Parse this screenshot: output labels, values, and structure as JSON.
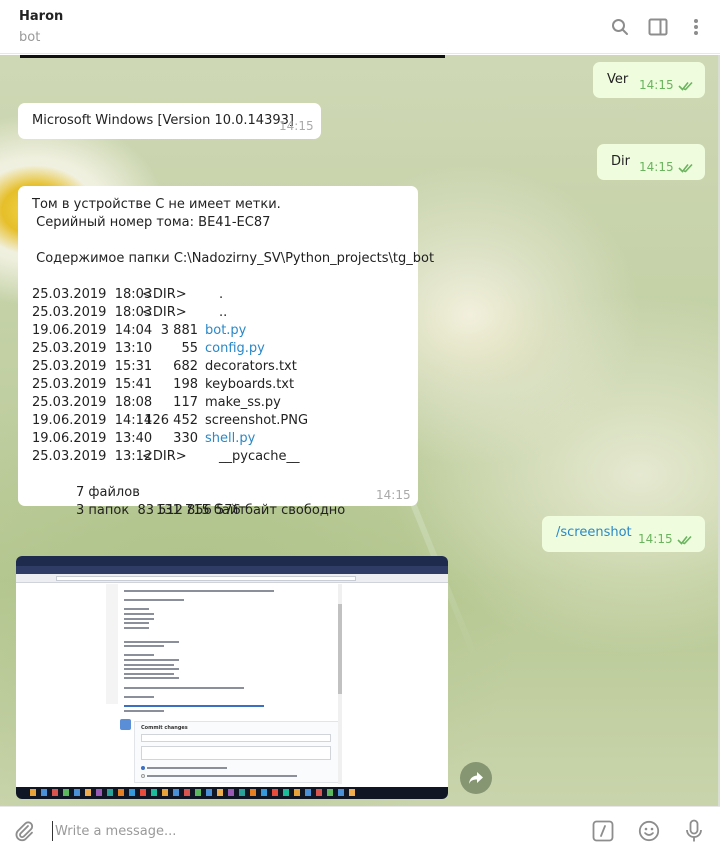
{
  "header": {
    "name": "Haron",
    "status": "bot"
  },
  "messages": {
    "ver": {
      "text": "Ver",
      "time": "14:15"
    },
    "ver_reply": {
      "text": "Microsoft Windows [Version 10.0.14393]",
      "time": "14:15"
    },
    "dir": {
      "text": "Dir",
      "time": "14:15"
    },
    "dir_reply": {
      "line1": "Том в устройстве C не имеет метки.",
      "line2": " Серийный номер тома: BE41-EC87",
      "line3": " Содержимое папки C:\\Nadozirny_SV\\Python_projects\\tg_bot",
      "entries": [
        {
          "date": "25.03.2019  18:03",
          "dir": "<DIR>",
          "size": "",
          "name": "."
        },
        {
          "date": "25.03.2019  18:03",
          "dir": "<DIR>",
          "size": "",
          "name": ".."
        },
        {
          "date": "19.06.2019  14:04",
          "dir": "",
          "size": "3 881",
          "name": "bot.py"
        },
        {
          "date": "25.03.2019  13:10",
          "dir": "",
          "size": "55",
          "name": "config.py"
        },
        {
          "date": "25.03.2019  15:31",
          "dir": "",
          "size": "682",
          "name": "decorators.txt"
        },
        {
          "date": "25.03.2019  15:41",
          "dir": "",
          "size": "198",
          "name": "keyboards.txt"
        },
        {
          "date": "25.03.2019  18:08",
          "dir": "",
          "size": "117",
          "name": "make_ss.py"
        },
        {
          "date": "19.06.2019  14:14",
          "dir": "",
          "size": "126 452",
          "name": "screenshot.PNG"
        },
        {
          "date": "19.06.2019  13:40",
          "dir": "",
          "size": "330",
          "name": "shell.py"
        },
        {
          "date": "25.03.2019  13:12",
          "dir": "<DIR>",
          "size": "",
          "name": "__pycache__"
        }
      ],
      "files_count": "7 файлов",
      "files_bytes": "131 715 байт",
      "dirs_line": "3 папок  83 512 856 576 байт свободно",
      "time": "14:15"
    },
    "screenshot": {
      "text": "/screenshot",
      "time": "14:15"
    }
  },
  "screenshot_image": {
    "commit_title": "Commit changes"
  },
  "input": {
    "placeholder": "Write a message..."
  },
  "colors": {
    "outgoing_bubble": "#effdde",
    "incoming_bubble": "#ffffff",
    "link": "#2a88c8",
    "check": "#6bb45f"
  },
  "icons": [
    "search-icon",
    "sidebar-toggle-icon",
    "more-vertical-icon",
    "double-check-icon",
    "share-icon",
    "attach-icon",
    "commands-icon",
    "emoji-icon",
    "microphone-icon"
  ]
}
